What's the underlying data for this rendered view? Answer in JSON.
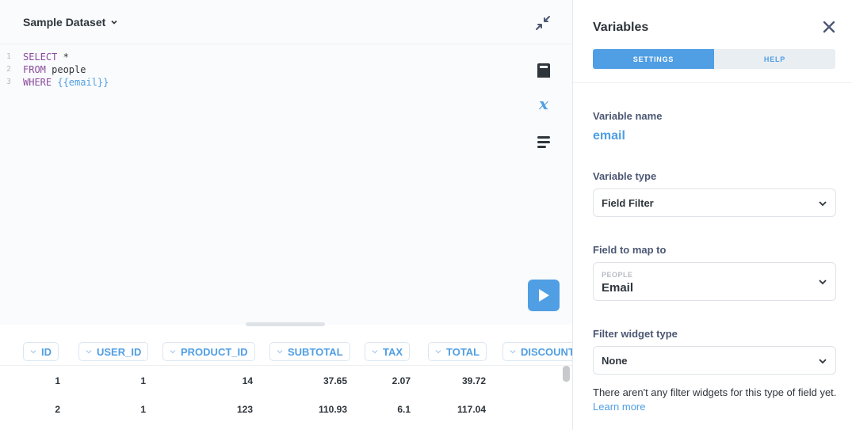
{
  "editor": {
    "dataset_label": "Sample Dataset",
    "lines": [
      {
        "num": "1",
        "kw": "SELECT",
        "rest": " *",
        "var": ""
      },
      {
        "num": "2",
        "kw": "FROM",
        "rest": " people",
        "var": ""
      },
      {
        "num": "3",
        "kw": "WHERE",
        "rest": " ",
        "var": "{{email}}"
      }
    ]
  },
  "table": {
    "columns": [
      "ID",
      "USER_ID",
      "PRODUCT_ID",
      "SUBTOTAL",
      "TAX",
      "TOTAL",
      "DISCOUNT"
    ],
    "rows": [
      [
        "1",
        "1",
        "14",
        "37.65",
        "2.07",
        "39.72"
      ],
      [
        "2",
        "1",
        "123",
        "110.93",
        "6.1",
        "117.04"
      ]
    ]
  },
  "panel": {
    "title": "Variables",
    "tabs": [
      "SETTINGS",
      "HELP"
    ],
    "variable_name_label": "Variable name",
    "variable_name": "email",
    "variable_type_label": "Variable type",
    "variable_type": "Field Filter",
    "field_map_label": "Field to map to",
    "field_table": "PEOPLE",
    "field_name": "Email",
    "widget_label": "Filter widget type",
    "widget_value": "None",
    "help_text": "There aren't any filter widgets for this type of field yet.",
    "learn_more": "Learn more"
  },
  "colors": {
    "accent": "#509ee3",
    "keyword": "#8b4a9c",
    "text": "#2e353b"
  }
}
